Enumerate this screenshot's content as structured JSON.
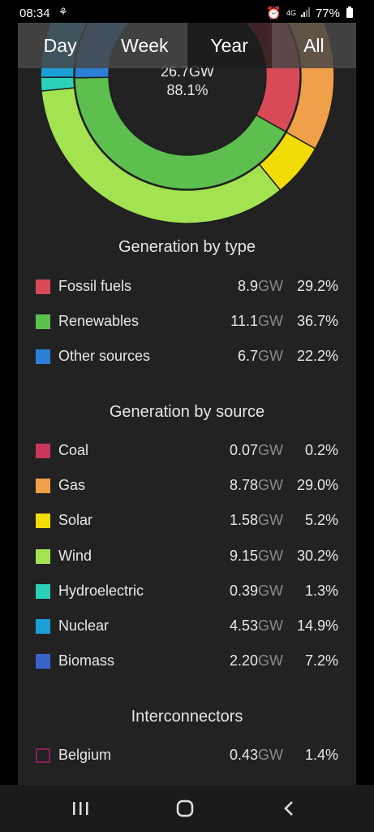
{
  "status_bar": {
    "time": "08:34",
    "network": "4G",
    "battery": "77%"
  },
  "tabs": [
    {
      "label": "Day",
      "active": false
    },
    {
      "label": "Week",
      "active": false
    },
    {
      "label": "Year",
      "active": true
    },
    {
      "label": "All",
      "active": false
    }
  ],
  "donut": {
    "center_value": "26.7GW",
    "center_percent": "88.1%"
  },
  "chart_data": {
    "type": "pie",
    "inner_ring_by_type": [
      {
        "name": "Fossil fuels",
        "value": 29.2,
        "color": "#d94a58"
      },
      {
        "name": "Renewables",
        "value": 36.7,
        "color": "#5cbf4e"
      },
      {
        "name": "Other sources",
        "value": 22.2,
        "color": "#2b7fd6"
      }
    ],
    "outer_ring_by_source": [
      {
        "name": "Coal",
        "value": 0.2,
        "color": "#c7375a"
      },
      {
        "name": "Gas",
        "value": 29.0,
        "color": "#f0a048"
      },
      {
        "name": "Solar",
        "value": 5.2,
        "color": "#f1dc07"
      },
      {
        "name": "Wind",
        "value": 30.2,
        "color": "#a3e250"
      },
      {
        "name": "Hydroelectric",
        "value": 1.3,
        "color": "#2bd0b8"
      },
      {
        "name": "Nuclear",
        "value": 14.9,
        "color": "#1a9fd6"
      },
      {
        "name": "Biomass",
        "value": 7.2,
        "color": "#3a64c8"
      }
    ]
  },
  "sections": {
    "by_type_title": "Generation by type",
    "by_source_title": "Generation by source",
    "interconnectors_title": "Interconnectors"
  },
  "by_type": [
    {
      "label": "Fossil fuels",
      "value": "8.9",
      "unit": "GW",
      "pct": "29.2%",
      "color": "#d94a58"
    },
    {
      "label": "Renewables",
      "value": "11.1",
      "unit": "GW",
      "pct": "36.7%",
      "color": "#5cbf4e"
    },
    {
      "label": "Other sources",
      "value": "6.7",
      "unit": "GW",
      "pct": "22.2%",
      "color": "#2b7fd6"
    }
  ],
  "by_source": [
    {
      "label": "Coal",
      "value": "0.07",
      "unit": "GW",
      "pct": "0.2%",
      "color": "#c7375a"
    },
    {
      "label": "Gas",
      "value": "8.78",
      "unit": "GW",
      "pct": "29.0%",
      "color": "#f0a048"
    },
    {
      "label": "Solar",
      "value": "1.58",
      "unit": "GW",
      "pct": "5.2%",
      "color": "#f1dc07"
    },
    {
      "label": "Wind",
      "value": "9.15",
      "unit": "GW",
      "pct": "30.2%",
      "color": "#a3e250"
    },
    {
      "label": "Hydroelectric",
      "value": "0.39",
      "unit": "GW",
      "pct": "1.3%",
      "color": "#2bd0b8"
    },
    {
      "label": "Nuclear",
      "value": "4.53",
      "unit": "GW",
      "pct": "14.9%",
      "color": "#1a9fd6"
    },
    {
      "label": "Biomass",
      "value": "2.20",
      "unit": "GW",
      "pct": "7.2%",
      "color": "#3a64c8"
    }
  ],
  "interconnectors": [
    {
      "label": "Belgium",
      "value": "0.43",
      "unit": "GW",
      "pct": "1.4%",
      "color": "#8a1d5e"
    }
  ]
}
